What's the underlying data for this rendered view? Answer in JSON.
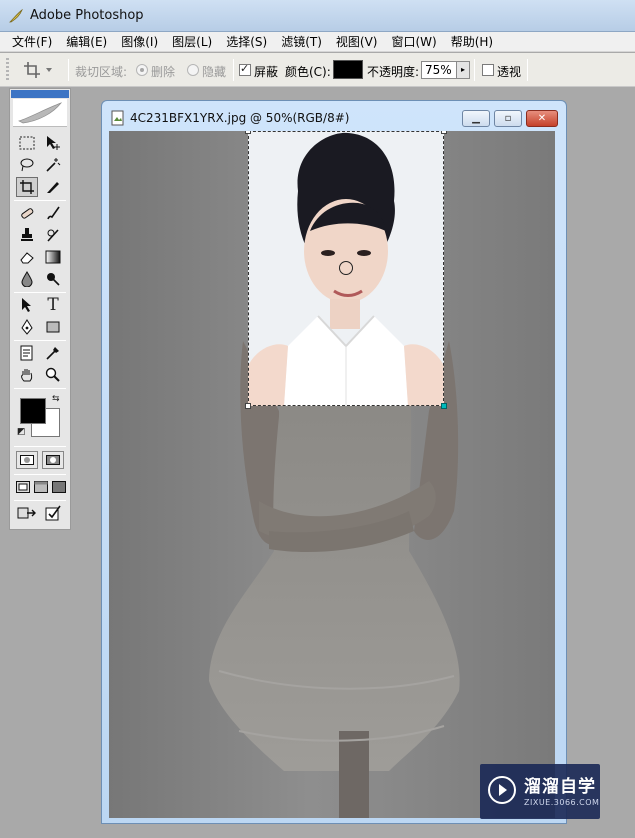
{
  "app": {
    "title": "Adobe Photoshop"
  },
  "menu": {
    "items": [
      "文件(F)",
      "编辑(E)",
      "图像(I)",
      "图层(L)",
      "选择(S)",
      "滤镜(T)",
      "视图(V)",
      "窗口(W)",
      "帮助(H)"
    ]
  },
  "options": {
    "crop_area_label": "裁切区域:",
    "delete_label": "删除",
    "hide_label": "隐藏",
    "shield_label": "屏蔽",
    "shield_checked": true,
    "color_label": "颜色(C):",
    "opacity_label": "不透明度:",
    "opacity_value": "75%",
    "perspective_label": "透视",
    "perspective_checked": false,
    "shield_color": "#000000"
  },
  "toolbox": {
    "foreground_color": "#000000",
    "background_color": "#ffffff"
  },
  "document": {
    "title": "4C231BFX1YRX.jpg @ 50%(RGB/8#)",
    "zoom_percent": 50
  },
  "watermark": {
    "name": "溜溜自学",
    "url": "ZIXUE.3066.COM"
  }
}
